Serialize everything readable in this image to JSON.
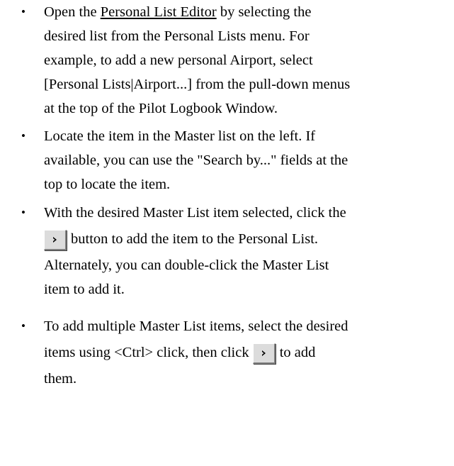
{
  "bullet_symbol": "•",
  "icons": {
    "add_button_icon": "chevron-right-icon"
  },
  "items": [
    {
      "line1_pre": "Open the ",
      "line1_link": "Personal List Editor",
      "line1_post": " by selecting the",
      "line2": "desired list from the Personal Lists menu.  For",
      "line3": "example, to add a new personal Airport, select",
      "line4": "[Personal Lists|Airport...] from the pull-down menus",
      "line5": "at the top of the Pilot Logbook Window."
    },
    {
      "line1": "Locate the item in the Master list on the left. If",
      "line2": "available, you can use the \"Search by...\" fields at the",
      "line3": "top to locate the item."
    },
    {
      "line1": "With the desired Master List item selected, click the",
      "line2_post": "button to add the item to the Personal List.",
      "line3": "Alternately, you can double-click the Master List",
      "line4": "item to add it."
    },
    {
      "line1": "To add multiple Master List items, select the desired",
      "line2_pre": "items using <Ctrl> click, then click ",
      "line2_post": "to add",
      "line3": "them."
    }
  ]
}
